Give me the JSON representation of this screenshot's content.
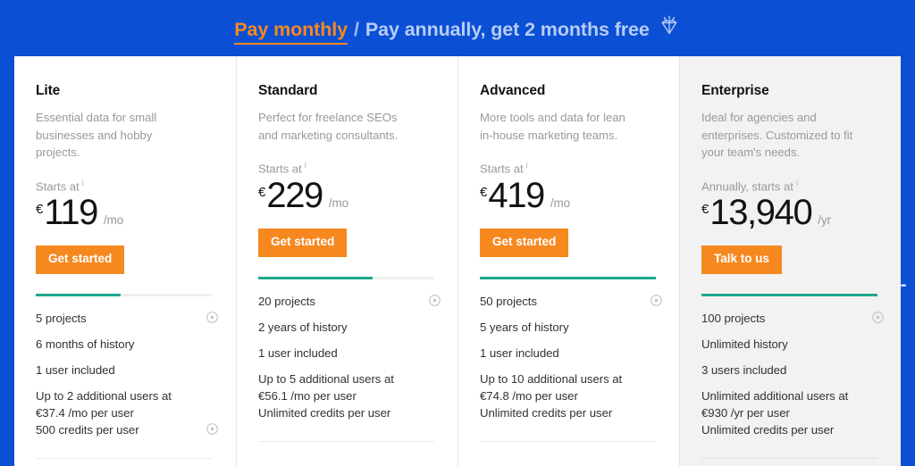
{
  "header": {
    "toggle_active": "Pay monthly",
    "separator": "/",
    "toggle_inactive": "Pay annually, get 2 months free",
    "gem_icon": "gem-icon"
  },
  "colors": {
    "background_blue": "#0b4fd4",
    "accent_orange": "#f68820",
    "meter_teal": "#1fa88e",
    "card_white": "#ffffff",
    "card_gray": "#f2f2f2",
    "muted_text": "#9a9a9a",
    "body_text": "#2f3234"
  },
  "plans": [
    {
      "name": "Lite",
      "description": "Essential data for small businesses and hobby projects.",
      "starts_at_label": "Starts at",
      "info_icon": "i",
      "currency": "€",
      "price": "119",
      "period": "/mo",
      "cta_label": "Get started",
      "meter_percent": 48,
      "features": [
        {
          "text": "5 projects",
          "icon": "play-circle-icon"
        },
        {
          "text": "6 months of history",
          "icon": null
        },
        {
          "text": "1 user included",
          "icon": null
        },
        {
          "text": "Up to 2 additional users at €37.4 /mo per user",
          "icon": null
        },
        {
          "text": "500 credits per user",
          "icon": "play-circle-icon"
        }
      ]
    },
    {
      "name": "Standard",
      "description": "Perfect for freelance SEOs and marketing consultants.",
      "starts_at_label": "Starts at",
      "info_icon": "i",
      "currency": "€",
      "price": "229",
      "period": "/mo",
      "cta_label": "Get started",
      "meter_percent": 65,
      "features": [
        {
          "text": "20 projects",
          "icon": "play-circle-icon"
        },
        {
          "text": "2 years of history",
          "icon": null
        },
        {
          "text": "1 user included",
          "icon": null
        },
        {
          "text": "Up to 5 additional users at €56.1 /mo per user",
          "icon": null
        },
        {
          "text": "Unlimited credits per user",
          "icon": null
        }
      ]
    },
    {
      "name": "Advanced",
      "description": "More tools and data for lean in-house marketing teams.",
      "starts_at_label": "Starts at",
      "info_icon": "i",
      "currency": "€",
      "price": "419",
      "period": "/mo",
      "cta_label": "Get started",
      "meter_percent": 100,
      "features": [
        {
          "text": "50 projects",
          "icon": "play-circle-icon"
        },
        {
          "text": "5 years of history",
          "icon": null
        },
        {
          "text": "1 user included",
          "icon": null
        },
        {
          "text": "Up to 10 additional users at €74.8 /mo per user",
          "icon": null
        },
        {
          "text": "Unlimited credits per user",
          "icon": null
        }
      ]
    },
    {
      "name": "Enterprise",
      "description": "Ideal for agencies and enterprises. Customized to fit your team's needs.",
      "starts_at_label": "Annually, starts at",
      "info_icon": "i",
      "currency": "€",
      "price": "13,940",
      "period": "/yr",
      "cta_label": "Talk to us",
      "meter_percent": 100,
      "features": [
        {
          "text": "100 projects",
          "icon": "play-circle-icon"
        },
        {
          "text": "Unlimited history",
          "icon": null
        },
        {
          "text": "3 users included",
          "icon": null
        },
        {
          "text": "Unlimited additional users at €930 /yr per user",
          "icon": null
        },
        {
          "text": "Unlimited credits per user",
          "icon": null
        }
      ]
    }
  ]
}
